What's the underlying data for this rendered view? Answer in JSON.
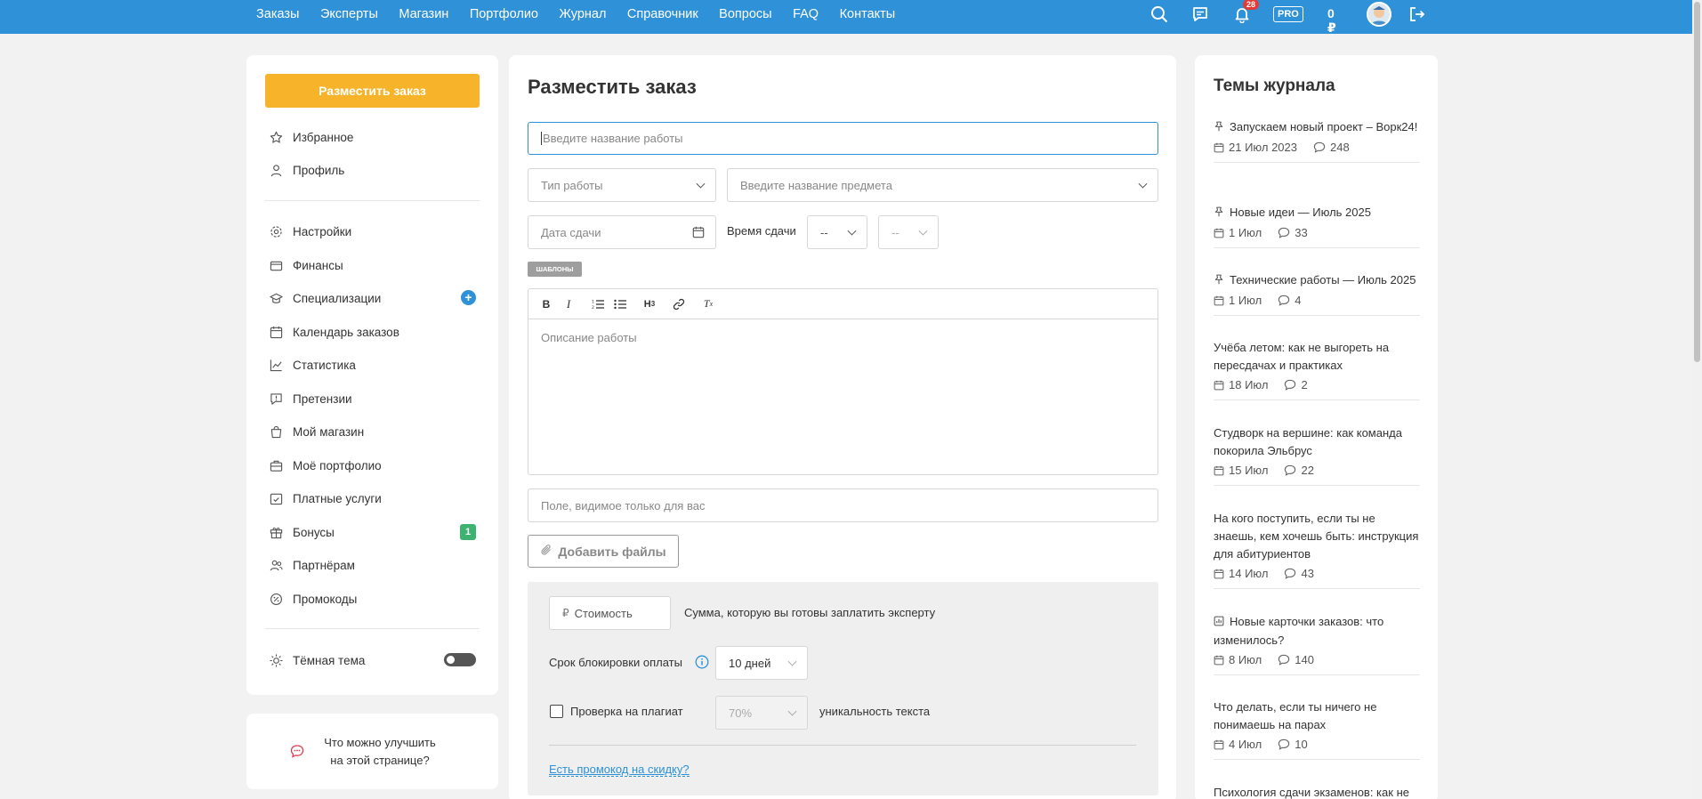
{
  "nav": {
    "items": [
      "Заказы",
      "Эксперты",
      "Магазин",
      "Портфолио",
      "Журнал",
      "Справочник",
      "Вопросы",
      "FAQ",
      "Контакты"
    ],
    "notifications_count": "28",
    "pro_label": "PRO",
    "balance": "0 ₽"
  },
  "sidebar": {
    "cta": "Разместить заказ",
    "items": [
      {
        "label": "Избранное",
        "icon": "star-icon"
      },
      {
        "label": "Профиль",
        "icon": "user-icon"
      },
      {
        "label": "Настройки",
        "icon": "gear-icon"
      },
      {
        "label": "Финансы",
        "icon": "wallet-icon"
      },
      {
        "label": "Специализации",
        "icon": "graduation-icon"
      },
      {
        "label": "Календарь заказов",
        "icon": "calendar-icon"
      },
      {
        "label": "Статистика",
        "icon": "chart-icon"
      },
      {
        "label": "Претензии",
        "icon": "claim-icon"
      },
      {
        "label": "Мой магазин",
        "icon": "bag-icon"
      },
      {
        "label": "Моё портфолио",
        "icon": "briefcase-icon"
      },
      {
        "label": "Платные услуги",
        "icon": "paid-calendar-icon"
      },
      {
        "label": "Бонусы",
        "icon": "gift-icon"
      },
      {
        "label": "Партнёрам",
        "icon": "partners-icon"
      },
      {
        "label": "Промокоды",
        "icon": "promo-icon"
      }
    ],
    "bonus_count": "1",
    "dark_theme": "Тёмная тема",
    "feedback_line1": "Что можно улучшить",
    "feedback_line2": "на этой странице?"
  },
  "form": {
    "title": "Разместить заказ",
    "work_name_placeholder": "Введите название работы",
    "work_type": "Тип работы",
    "subject_placeholder": "Введите название предмета",
    "due_date_placeholder": "Дата сдачи",
    "due_time_label": "Время сдачи",
    "hour": "--",
    "minute": "--",
    "templates": "ШАБЛОНЫ",
    "toolbar": [
      "B",
      "I",
      "ol",
      "ul",
      "H3",
      "link",
      "Tx"
    ],
    "description_placeholder": "Описание работы",
    "private_field_placeholder": "Поле, видимое только для вас",
    "add_files": "Добавить файлы",
    "price_placeholder": "Стоимость",
    "price_hint": "Сумма, которую вы готовы заплатить эксперту",
    "lock_label": "Срок блокировки оплаты",
    "lock_value": "10 дней",
    "plagiarism_label": "Проверка на плагиат",
    "plagiarism_value": "70%",
    "uniqueness_label": "уникальность текста",
    "promo_link": "Есть промокод на скидку?"
  },
  "journal": {
    "title": "Темы журнала",
    "posts": [
      {
        "title": "Запускаем новый проект – Ворк24!",
        "date": "21 Июл 2023",
        "comments": "248",
        "prefix": "pin-icon"
      },
      {
        "title": "Новые идеи — Июль 2025",
        "date": "1 Июл",
        "comments": "33",
        "prefix": "pin-icon"
      },
      {
        "title": "Технические работы — Июль 2025",
        "date": "1 Июл",
        "comments": "4",
        "prefix": "pin-icon"
      },
      {
        "title": "Учёба летом: как не выгореть на пересдачах и практиках",
        "date": "18 Июл",
        "comments": "2",
        "prefix": ""
      },
      {
        "title": "Студворк на вершине: как команда покорила Эльбрус",
        "date": "15 Июл",
        "comments": "22",
        "prefix": ""
      },
      {
        "title": "На кого поступить, если ты не знаешь, кем хочешь быть: инструкция для абитуриентов",
        "date": "14 Июл",
        "comments": "43",
        "prefix": ""
      },
      {
        "title": "Новые карточки заказов: что изменилось?",
        "date": "8 Июл",
        "comments": "140",
        "prefix": "chart-box-icon"
      },
      {
        "title": "Что делать, если ты ничего не понимаешь на парах",
        "date": "4 Июл",
        "comments": "10",
        "prefix": ""
      },
      {
        "title": "Психология сдачи экзаменов: как не",
        "date": "",
        "comments": "",
        "prefix": ""
      }
    ]
  },
  "colors": {
    "topbar": "#2f91d8",
    "cta": "#f7b329",
    "bonus": "#3cb371",
    "notif": "#e53935"
  }
}
